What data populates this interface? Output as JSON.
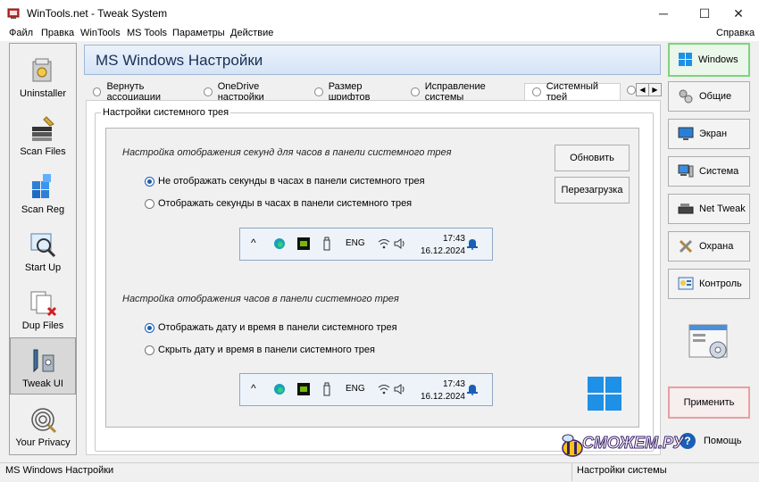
{
  "window": {
    "title": "WinTools.net - Tweak System",
    "minimize": "─",
    "maximize": "☐",
    "close": "✕"
  },
  "menu": {
    "items": [
      "Файл",
      "Правка",
      "WinTools",
      "MS Tools",
      "Параметры",
      "Действие"
    ],
    "help": "Справка"
  },
  "left_nav": [
    {
      "label": "Uninstaller"
    },
    {
      "label": "Scan Files"
    },
    {
      "label": "Scan Reg"
    },
    {
      "label": "Start Up"
    },
    {
      "label": "Dup Files"
    },
    {
      "label": "Tweak UI",
      "active": true
    },
    {
      "label": "Your Privacy"
    }
  ],
  "header": {
    "title": "MS Windows Настройки"
  },
  "tabs": [
    {
      "label": "Вернуть ассоциации"
    },
    {
      "label": "OneDrive настройки"
    },
    {
      "label": "Размер шрифтов"
    },
    {
      "label": "Исправление системы"
    },
    {
      "label": "Системный трей",
      "active": true
    }
  ],
  "tab_scroll": {
    "left": "◀",
    "right": "▶"
  },
  "group": {
    "legend": "Настройки системного трея",
    "section1": {
      "title": "Настройка отображения секунд для часов в панели системного трея",
      "options": [
        {
          "label": "Не отображать секунды в часах в панели системного трея",
          "checked": true
        },
        {
          "label": "Отображать секунды в часах в панели системного трея",
          "checked": false
        }
      ]
    },
    "section2": {
      "title": "Настройка отображения часов в панели системного трея",
      "options": [
        {
          "label": "Отображать дату и время в панели системного трея",
          "checked": true
        },
        {
          "label": "Скрыть дату и время в панели системного трея",
          "checked": false
        }
      ]
    },
    "buttons": {
      "refresh": "Обновить",
      "reboot": "Перезагрузка"
    },
    "tray": {
      "chevron": "^",
      "lang": "ENG",
      "time": "17:43",
      "date": "16.12.2024"
    }
  },
  "right_nav": [
    {
      "label": "Windows",
      "active": true
    },
    {
      "label": "Общие"
    },
    {
      "label": "Экран"
    },
    {
      "label": "Система"
    },
    {
      "label": "Net Tweak"
    },
    {
      "label": "Охрана"
    },
    {
      "label": "Контроль"
    }
  ],
  "actions": {
    "apply": "Применить",
    "help": "Помощь"
  },
  "status": {
    "left": "MS Windows Настройки",
    "right": "Настройки системы"
  },
  "watermark": "СМОЖЕМ.РУ",
  "colors": {
    "accent": "#1a5fb4",
    "windows_logo": "#1e90e6",
    "active_green": "#7fd27f",
    "apply_border": "#e8a0a0"
  }
}
